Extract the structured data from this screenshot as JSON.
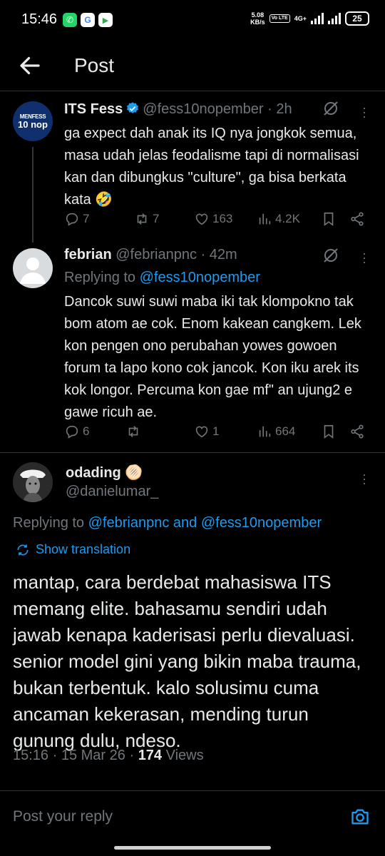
{
  "status_bar": {
    "time": "15:46",
    "speed_value": "5.08",
    "speed_unit": "KB/s",
    "volte": "Vo LTE",
    "network": "4G+",
    "battery": "25"
  },
  "header": {
    "title": "Post"
  },
  "tweets": [
    {
      "name": "ITS Fess",
      "handle": "@fess10nopember",
      "time": "· 2h",
      "avatar_text_1": "MENFESS",
      "avatar_text_2": "10 nop",
      "text": "ga expect dah anak its IQ nya jongkok semua, masa udah jelas feodalisme tapi di normalisasi kan dan dibungkus \"culture\", ga bisa berkata kata 🤣",
      "replies": "7",
      "retweets": "7",
      "likes": "163",
      "views": "4.2K"
    },
    {
      "name": "febrian",
      "handle": "@febrianpnc",
      "time": "· 42m",
      "replying_label": "Replying to",
      "replying_to": "@fess10nopember",
      "text": "Dancok suwi suwi maba iki tak klompokno tak bom atom ae cok. Enom kakean cangkem. Lek kon pengen ono perubahan yowes gowoen forum ta lapo kono cok jancok. Kon iku arek its kok longor. Percuma kon gae mf\" an ujung2 e gawe ricuh ae.",
      "replies": "6",
      "retweets": "",
      "likes": "1",
      "views": "664"
    }
  ],
  "main_post": {
    "name": "odading",
    "emoji": "🫓",
    "handle": "@danielumar_",
    "replying_label": "Replying to",
    "replying_to_1": "@febrianpnc",
    "replying_and": "and",
    "replying_to_2": "@fess10nopember",
    "show_translation": "Show translation",
    "text": "mantap, cara berdebat mahasiswa ITS memang elite. bahasamu sendiri udah jawab kenapa kaderisasi perlu dievaluasi. senior model gini yang bikin maba trauma, bukan terbentuk. kalo solusimu cuma ancaman kekerasan, mending turun gunung dulu, ndeso.",
    "time": "15:16",
    "date": "15 Mar 26",
    "views_count": "174",
    "views_label": "Views"
  },
  "reply_input": {
    "placeholder": "Post your reply"
  },
  "colors": {
    "background": "#000000",
    "text": "#e7e9ea",
    "muted": "#71767b",
    "link": "#1d9bf0",
    "verified": "#1d9bf0",
    "divider": "#2f3336"
  }
}
